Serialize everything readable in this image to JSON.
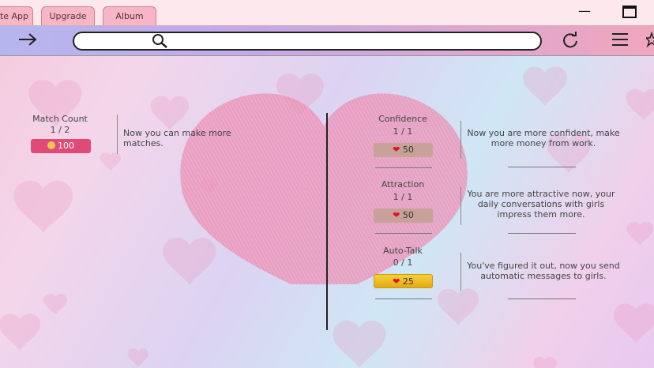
{
  "tabs": [
    {
      "label": "te App"
    },
    {
      "label": "Upgrade"
    },
    {
      "label": "Album"
    }
  ],
  "window": {
    "minimize_icon": "minimize-icon",
    "maximize_icon": "maximize-icon"
  },
  "navbar": {
    "back_icon": "arrow-right-icon",
    "search_icon": "search-icon",
    "refresh_icon": "refresh-icon",
    "menu_icon": "menu-icon",
    "star_icon": "star-icon"
  },
  "upgrades_left": [
    {
      "title": "Match Count",
      "count": "1 / 2",
      "cost": "100",
      "cost_icon": "coin-icon",
      "description": "Now you can make more matches."
    }
  ],
  "upgrades_right": [
    {
      "title": "Confidence",
      "count": "1 / 1",
      "cost": "50",
      "cost_icon": "heart-icon",
      "description": "Now you are more confident, make more money from work."
    },
    {
      "title": "Attraction",
      "count": "1 / 1",
      "cost": "50",
      "cost_icon": "heart-icon",
      "description": "You are more attractive now, your daily conversations with girls impress them more."
    },
    {
      "title": "Auto-Talk",
      "count": "0 / 1",
      "cost": "25",
      "cost_icon": "heart-icon",
      "description": "You've figured it out, now you send automatic messages to girls."
    }
  ]
}
